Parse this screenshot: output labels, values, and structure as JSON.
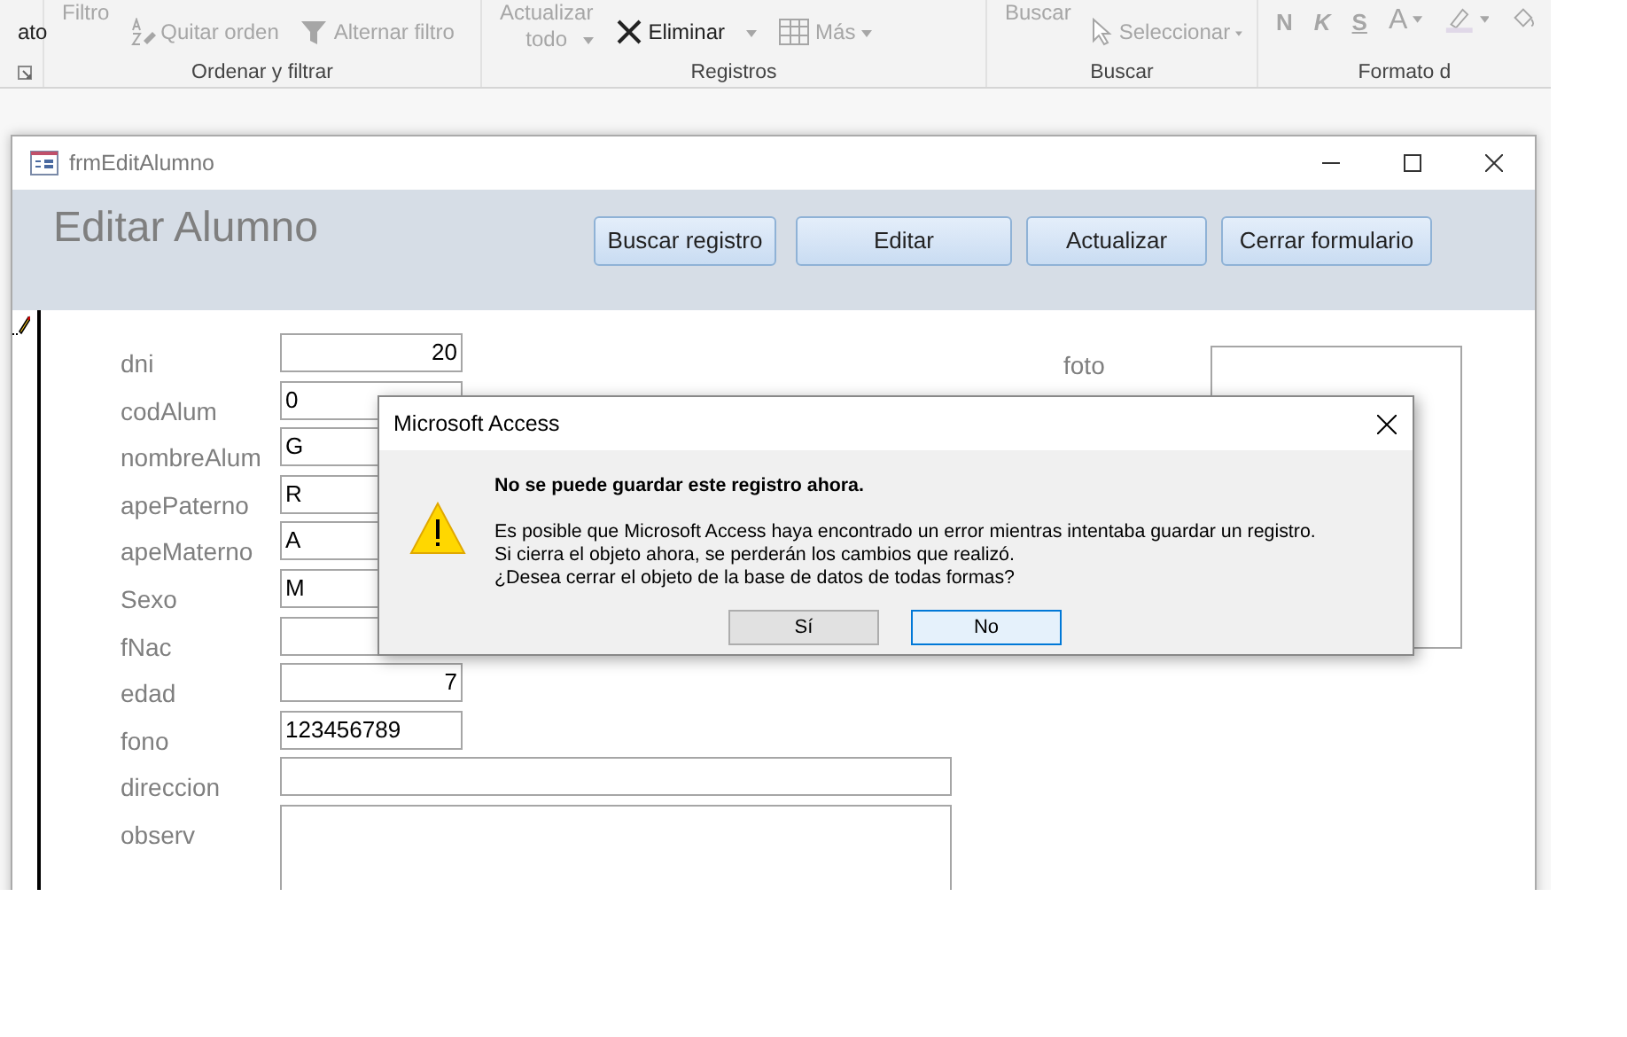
{
  "ribbon": {
    "groups": [
      {
        "launcher": true,
        "items": [
          {
            "kind": "text",
            "text": "ato",
            "disabled": false
          }
        ]
      },
      {
        "label": "Ordenar y filtrar",
        "items": [
          {
            "kind": "big",
            "text": "Filtro",
            "disabled": true
          },
          {
            "kind": "sort",
            "text": "Quitar orden",
            "disabled": true
          },
          {
            "kind": "filter",
            "text": "Alternar filtro",
            "disabled": true
          }
        ]
      },
      {
        "label": "Registros",
        "items": [
          {
            "kind": "big",
            "text": "Actualizar",
            "text2": "todo",
            "disabled": true,
            "dropdown": true
          },
          {
            "kind": "delete",
            "text": "Eliminar",
            "disabled": false,
            "dropdown": true
          },
          {
            "kind": "more",
            "text": "Más",
            "disabled": true,
            "dropdown": true
          }
        ]
      },
      {
        "label": "Buscar",
        "items": [
          {
            "kind": "big",
            "text": "Buscar",
            "disabled": true
          },
          {
            "kind": "select",
            "text": "Seleccionar",
            "disabled": true,
            "dropdown": true
          }
        ]
      },
      {
        "label": "Formato d",
        "items": [
          {
            "kind": "format",
            "text": "N",
            "disabled": true
          },
          {
            "kind": "format",
            "text": "K",
            "disabled": true
          },
          {
            "kind": "format",
            "text": "S",
            "disabled": true
          },
          {
            "kind": "color",
            "text": "A",
            "disabled": true,
            "dropdown": true
          },
          {
            "kind": "highlight",
            "disabled": true,
            "dropdown": true
          },
          {
            "kind": "fill",
            "disabled": true
          }
        ]
      }
    ]
  },
  "form": {
    "title": "frmEditAlumno",
    "heading": "Editar Alumno",
    "buttons": [
      "Buscar registro",
      "Editar",
      "Actualizar",
      "Cerrar formulario"
    ],
    "fields": [
      {
        "label": "dni",
        "kind": "number",
        "value": "20"
      },
      {
        "label": "codAlum",
        "kind": "text",
        "value": "0"
      },
      {
        "label": "nombreAlum",
        "kind": "text",
        "value": "G"
      },
      {
        "label": "apePaterno",
        "kind": "text",
        "value": "R"
      },
      {
        "label": "apeMaterno",
        "kind": "text",
        "value": "A"
      },
      {
        "label": "Sexo",
        "kind": "text",
        "value": "M"
      },
      {
        "label": "fNac",
        "kind": "date"
      },
      {
        "label": "edad",
        "kind": "number",
        "value": "7"
      },
      {
        "label": "fono",
        "kind": "text",
        "value": "123456789"
      },
      {
        "label": "direccion",
        "kind": "wide"
      },
      {
        "label": "observ",
        "kind": "memo"
      }
    ],
    "photo_label": "foto"
  },
  "dialog": {
    "title": "Microsoft Access",
    "heading": "No se puede guardar este registro ahora.",
    "message": "Es posible que Microsoft Access haya encontrado un error mientras intentaba guardar un registro.\nSi cierra el objeto ahora, se perderán los cambios que realizó.\n¿Desea cerrar el objeto de la base de datos de todas formas?",
    "buttons": [
      {
        "label": "Sí",
        "default": false
      },
      {
        "label": "No",
        "default": true
      }
    ]
  }
}
